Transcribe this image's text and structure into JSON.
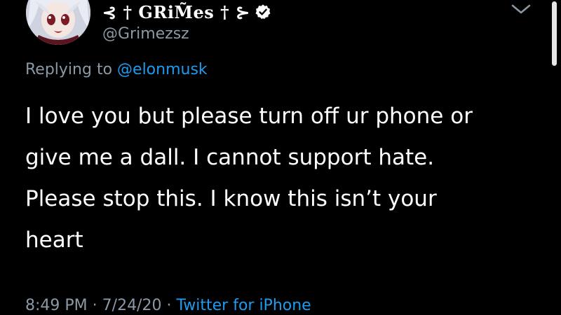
{
  "author": {
    "display_name": "⊰ † GRiM̃es † ⊱",
    "handle": "@Grimezsz",
    "verified": true,
    "avatar": "anime-character-avatar"
  },
  "reply": {
    "prefix": "Replying to",
    "mention": "@elonmusk"
  },
  "tweet": {
    "lines": [
      "I love you but please turn off ur phone or",
      "give me a dall.  I cannot support hate.",
      "Please stop this. I know this isn’t your",
      "heart"
    ]
  },
  "meta": {
    "time": "8:49 PM",
    "sep1": "·",
    "date": "7/24/20",
    "sep2": "·",
    "source": "Twitter for iPhone"
  },
  "colors": {
    "background": "#000000",
    "text": "#ffffff",
    "secondary": "#8b98a5",
    "link": "#1d9bf0"
  },
  "icons": {
    "verified": "verified-badge-icon",
    "more": "chevron-down-icon"
  }
}
